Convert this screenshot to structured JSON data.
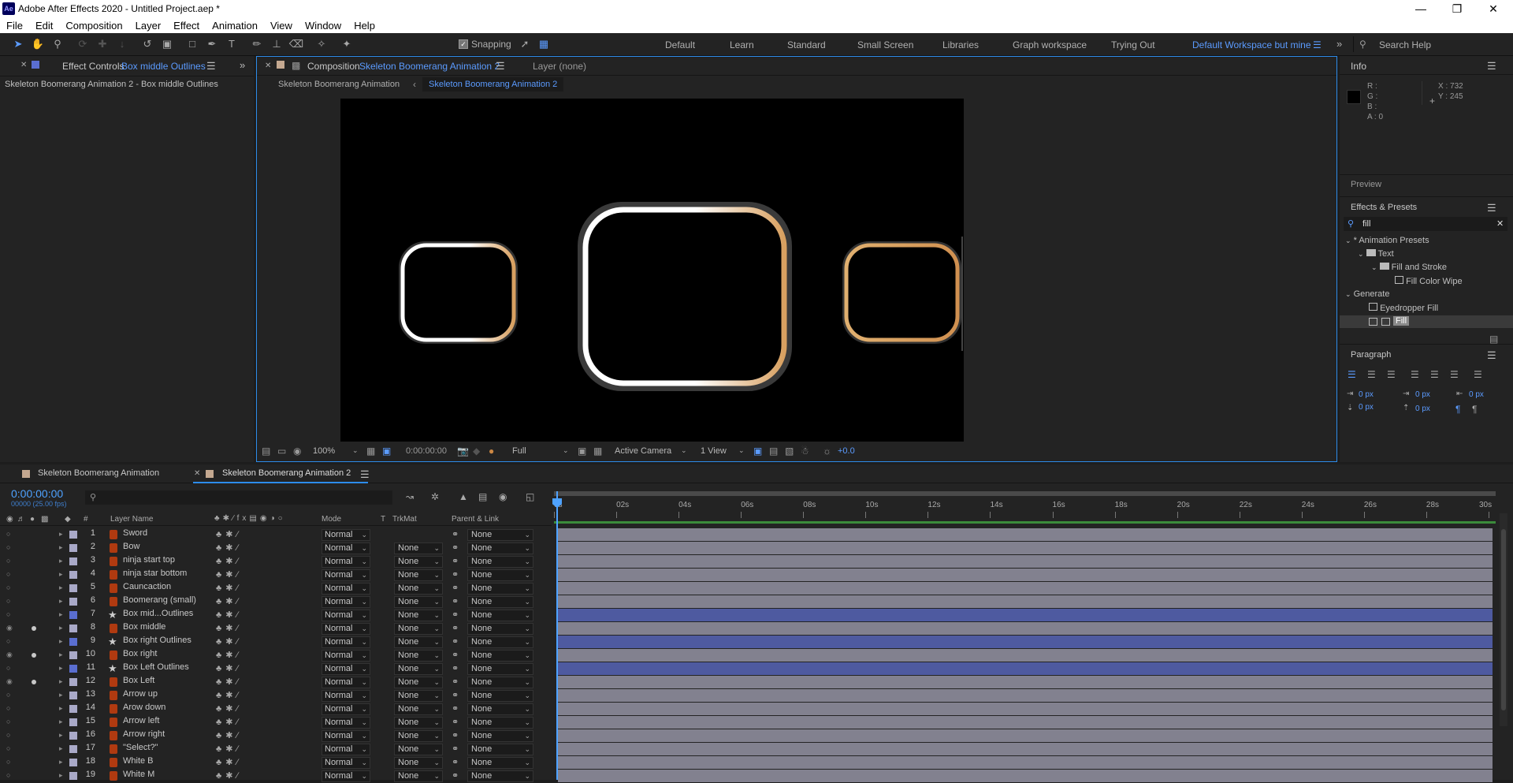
{
  "window": {
    "title": "Adobe After Effects 2020 - Untitled Project.aep *",
    "app_icon": "Ae"
  },
  "menu": [
    "File",
    "Edit",
    "Composition",
    "Layer",
    "Effect",
    "Animation",
    "View",
    "Window",
    "Help"
  ],
  "toolbar": {
    "snapping_label": "Snapping",
    "workspaces": [
      "Default",
      "Learn",
      "Standard",
      "Small Screen",
      "Libraries",
      "Graph workspace",
      "Trying Out",
      "Default Workspace but mine"
    ],
    "active_workspace": "Default Workspace but mine",
    "search_placeholder": "Search Help"
  },
  "effect_controls": {
    "tab_label": "Effect Controls",
    "tab_layer": "Box middle Outlines",
    "subtitle": "Skeleton Boomerang Animation 2 - Box middle Outlines"
  },
  "composition": {
    "tab_label": "Composition",
    "tab_comp": "Skeleton Boomerang Animation 2",
    "layer_tab": "Layer  (none)",
    "breadcrumb_parent": "Skeleton Boomerang Animation",
    "breadcrumb_current": "Skeleton Boomerang Animation 2"
  },
  "viewer_controls": {
    "zoom": "100%",
    "timecode": "0:00:00:00",
    "resolution": "Full",
    "camera": "Active Camera",
    "views": "1 View",
    "exposure": "+0.0"
  },
  "info": {
    "title": "Info",
    "r": "R :",
    "g": "G :",
    "b": "B :",
    "a": "A :  0",
    "x": "X : 732",
    "y": "Y : 245"
  },
  "preview": {
    "title": "Preview"
  },
  "effects_presets": {
    "title": "Effects & Presets",
    "search": "fill",
    "tree": [
      {
        "label": "* Animation Presets",
        "level": 0,
        "type": "group"
      },
      {
        "label": "Text",
        "level": 1,
        "type": "folder"
      },
      {
        "label": "Fill and Stroke",
        "level": 2,
        "type": "folder"
      },
      {
        "label": "Fill Color Wipe",
        "level": 3,
        "type": "preset"
      },
      {
        "label": "Generate",
        "level": 0,
        "type": "group"
      },
      {
        "label": "Eyedropper Fill",
        "level": 1,
        "type": "effect"
      },
      {
        "label": "Fill",
        "level": 1,
        "type": "effect-selected"
      }
    ]
  },
  "paragraph": {
    "title": "Paragraph",
    "indent_left": "0 px",
    "indent_first": "0 px",
    "indent_right": "0 px",
    "space_before": "0 px",
    "space_after": "0 px"
  },
  "timeline": {
    "tabs": [
      "Skeleton Boomerang Animation",
      "Skeleton Boomerang Animation 2"
    ],
    "active_tab": "Skeleton Boomerang Animation 2",
    "timecode": "0:00:00:00",
    "frame_info": "00000 (25.00 fps)",
    "columns": {
      "num": "#",
      "layer_name": "Layer Name",
      "mode": "Mode",
      "t": "T",
      "trkmat": "TrkMat",
      "parent": "Parent & Link"
    },
    "ruler": [
      "0s",
      "02s",
      "04s",
      "06s",
      "08s",
      "10s",
      "12s",
      "14s",
      "16s",
      "18s",
      "20s",
      "22s",
      "24s",
      "26s",
      "28s",
      "30s"
    ],
    "layers": [
      {
        "num": "1",
        "name": "Sword",
        "mode": "Normal",
        "trkmat": "",
        "parent": "None",
        "shape": false,
        "visible": false,
        "solo": false,
        "color": "#a9a9c8"
      },
      {
        "num": "2",
        "name": "Bow",
        "mode": "Normal",
        "trkmat": "None",
        "parent": "None",
        "shape": false,
        "visible": false,
        "solo": false,
        "color": "#a9a9c8"
      },
      {
        "num": "3",
        "name": "ninja start top",
        "mode": "Normal",
        "trkmat": "None",
        "parent": "None",
        "shape": false,
        "visible": false,
        "solo": false,
        "color": "#a9a9c8"
      },
      {
        "num": "4",
        "name": "ninja star bottom",
        "mode": "Normal",
        "trkmat": "None",
        "parent": "None",
        "shape": false,
        "visible": false,
        "solo": false,
        "color": "#a9a9c8"
      },
      {
        "num": "5",
        "name": "Cauncaction",
        "mode": "Normal",
        "trkmat": "None",
        "parent": "None",
        "shape": false,
        "visible": false,
        "solo": false,
        "color": "#a9a9c8"
      },
      {
        "num": "6",
        "name": "Boomerang (small)",
        "mode": "Normal",
        "trkmat": "None",
        "parent": "None",
        "shape": false,
        "visible": false,
        "solo": false,
        "color": "#a9a9c8"
      },
      {
        "num": "7",
        "name": "Box mid...Outlines",
        "mode": "Normal",
        "trkmat": "None",
        "parent": "None",
        "shape": true,
        "visible": false,
        "solo": false,
        "color": "#5a6ed0"
      },
      {
        "num": "8",
        "name": "Box middle",
        "mode": "Normal",
        "trkmat": "None",
        "parent": "None",
        "shape": false,
        "visible": true,
        "solo": true,
        "color": "#a9a9c8"
      },
      {
        "num": "9",
        "name": "Box right Outlines",
        "mode": "Normal",
        "trkmat": "None",
        "parent": "None",
        "shape": true,
        "visible": false,
        "solo": false,
        "color": "#5a6ed0"
      },
      {
        "num": "10",
        "name": "Box right",
        "mode": "Normal",
        "trkmat": "None",
        "parent": "None",
        "shape": false,
        "visible": true,
        "solo": true,
        "color": "#a9a9c8"
      },
      {
        "num": "11",
        "name": "Box Left Outlines",
        "mode": "Normal",
        "trkmat": "None",
        "parent": "None",
        "shape": true,
        "visible": false,
        "solo": false,
        "color": "#5a6ed0"
      },
      {
        "num": "12",
        "name": "Box Left",
        "mode": "Normal",
        "trkmat": "None",
        "parent": "None",
        "shape": false,
        "visible": true,
        "solo": true,
        "color": "#a9a9c8"
      },
      {
        "num": "13",
        "name": "Arrow up",
        "mode": "Normal",
        "trkmat": "None",
        "parent": "None",
        "shape": false,
        "visible": false,
        "solo": false,
        "color": "#a9a9c8"
      },
      {
        "num": "14",
        "name": "Arow down",
        "mode": "Normal",
        "trkmat": "None",
        "parent": "None",
        "shape": false,
        "visible": false,
        "solo": false,
        "color": "#a9a9c8"
      },
      {
        "num": "15",
        "name": "Arrow left",
        "mode": "Normal",
        "trkmat": "None",
        "parent": "None",
        "shape": false,
        "visible": false,
        "solo": false,
        "color": "#a9a9c8"
      },
      {
        "num": "16",
        "name": "Arrow right",
        "mode": "Normal",
        "trkmat": "None",
        "parent": "None",
        "shape": false,
        "visible": false,
        "solo": false,
        "color": "#a9a9c8"
      },
      {
        "num": "17",
        "name": "\"Select?\"",
        "mode": "Normal",
        "trkmat": "None",
        "parent": "None",
        "shape": false,
        "visible": false,
        "solo": false,
        "color": "#a9a9c8"
      },
      {
        "num": "18",
        "name": "White B",
        "mode": "Normal",
        "trkmat": "None",
        "parent": "None",
        "shape": false,
        "visible": false,
        "solo": false,
        "color": "#a9a9c8"
      },
      {
        "num": "19",
        "name": "White M",
        "mode": "Normal",
        "trkmat": "None",
        "parent": "None",
        "shape": false,
        "visible": false,
        "solo": false,
        "color": "#a9a9c8"
      }
    ]
  },
  "colors": {
    "accent": "#5b9bff",
    "panel_bg": "#232323",
    "comp_border": "#2d8ceb",
    "shape_bar": "#4e5aa0",
    "layer_bar": "#82818f"
  }
}
